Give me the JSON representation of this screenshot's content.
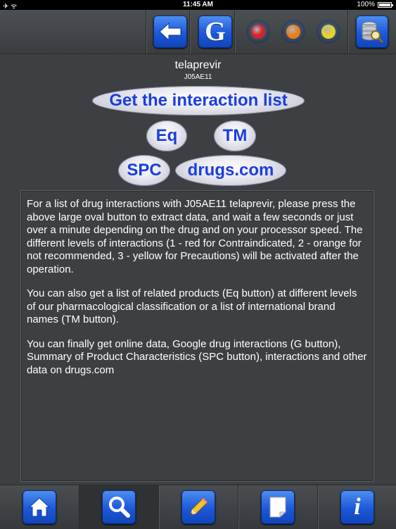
{
  "status_bar": {
    "time": "11:45 AM",
    "battery": "100%"
  },
  "toolbar": {
    "back_label": "back",
    "google_label": "G",
    "dot_colors": [
      "#d8232a",
      "#e87f1f",
      "#e6d22a"
    ]
  },
  "header": {
    "drug_name": "telaprevir",
    "atc_code": "J05AE11"
  },
  "actions": {
    "interaction_list": "Get the interaction list",
    "eq": "Eq",
    "tm": "TM",
    "spc": "SPC",
    "drugs_com": "drugs.com"
  },
  "content": {
    "paragraphs": [
      "For a list of drug interactions with J05AE11 telaprevir, please press the above large oval button to extract data, and wait a few seconds or just over a minute depending on the drug and on your processor speed. The different levels of interactions (1 - red for Contraindicated, 2 - orange for not recommended, 3 - yellow for Precautions) will be activated after the operation.",
      "You can also get a list of related products (Eq button) at different levels of our pharmacological classification or a list of international brand names (TM button).",
      "You can finally get online data, Google drug interactions (G button), Summary of Product Characteristics (SPC button), interactions and other data on drugs.com"
    ]
  },
  "tabbar": {
    "tabs": [
      {
        "icon": "home-icon",
        "active": false
      },
      {
        "icon": "search-icon",
        "active": true
      },
      {
        "icon": "pencil-icon",
        "active": false
      },
      {
        "icon": "note-icon",
        "active": false
      },
      {
        "icon": "info-icon",
        "active": false
      }
    ]
  }
}
